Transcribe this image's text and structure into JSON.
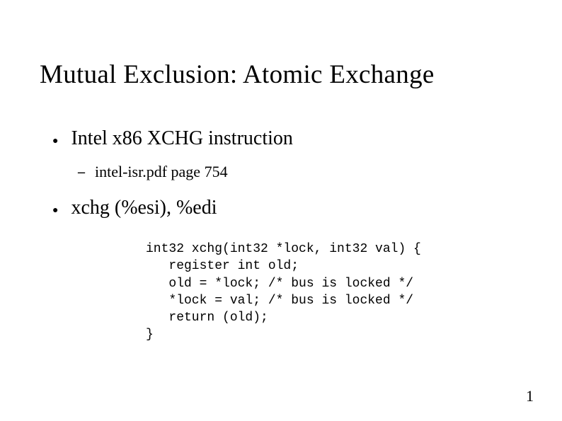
{
  "title": "Mutual Exclusion: Atomic Exchange",
  "bullets": [
    {
      "text": "Intel x86 XCHG instruction",
      "sub": "intel-isr.pdf page 754"
    },
    {
      "text": "xchg (%esi), %edi"
    }
  ],
  "code": "int32 xchg(int32 *lock, int32 val) {\n   register int old;\n   old = *lock; /* bus is locked */\n   *lock = val; /* bus is locked */\n   return (old);\n}",
  "page_number": "1"
}
